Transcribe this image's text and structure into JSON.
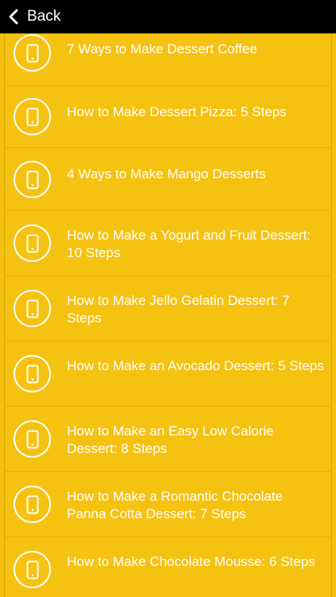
{
  "header": {
    "back_label": "Back"
  },
  "items": [
    {
      "title": "7 Ways to Make Dessert Coffee",
      "icon": "phone-icon"
    },
    {
      "title": "How to Make Dessert Pizza: 5 Steps",
      "icon": "phone-icon"
    },
    {
      "title": "4 Ways to Make Mango Desserts",
      "icon": "phone-icon"
    },
    {
      "title": "How to Make a Yogurt and Fruit Dessert: 10 Steps",
      "icon": "phone-icon"
    },
    {
      "title": "How to Make Jello Gelatin Dessert: 7 Steps",
      "icon": "phone-icon"
    },
    {
      "title": "How to Make an Avocado Dessert: 5 Steps",
      "icon": "phone-icon"
    },
    {
      "title": "How to Make an Easy Low Calorie Dessert: 8 Steps",
      "icon": "phone-icon"
    },
    {
      "title": "How to Make a Romantic Chocolate Panna Cotta Dessert: 7 Steps",
      "icon": "phone-icon"
    },
    {
      "title": "How to Make Chocolate Mousse: 6 Steps",
      "icon": "phone-icon"
    }
  ],
  "colors": {
    "background": "#F5C211",
    "header": "#000000",
    "text": "#FFFFFF"
  }
}
